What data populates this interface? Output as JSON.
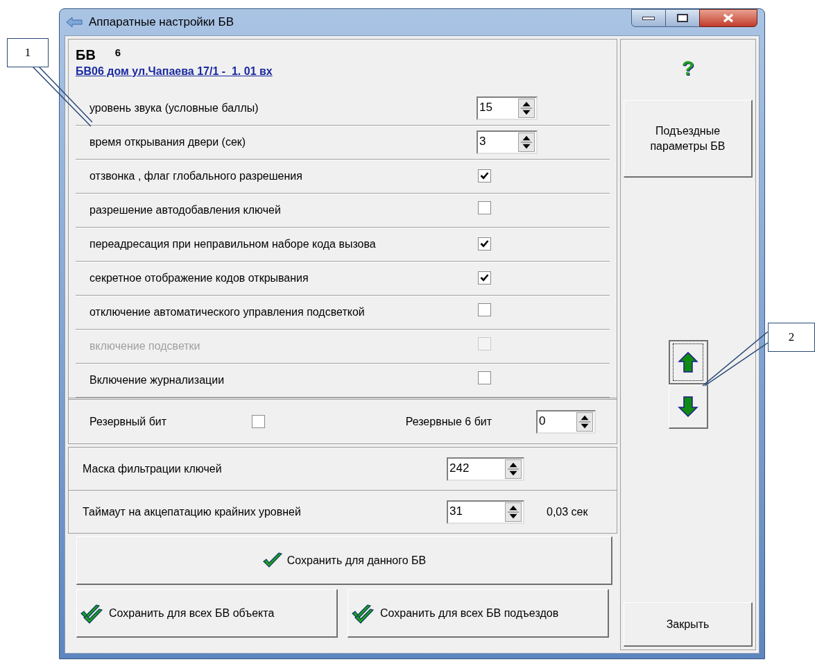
{
  "window": {
    "title": "Аппаратные настройки БВ"
  },
  "header": {
    "label": "БВ",
    "number": "6",
    "link": "БВ06 дом ул.Чапаева 17/1 -  1. 01 вх"
  },
  "settings": [
    {
      "kind": "spin",
      "label": "уровень звука (условные баллы)",
      "value": "15"
    },
    {
      "kind": "spin",
      "label": "время открывания двери (сек)",
      "value": "3"
    },
    {
      "kind": "check",
      "label": "отзвонка , флаг глобального разрешения",
      "checked": true,
      "disabled": false
    },
    {
      "kind": "check",
      "label": "разрешение автодобавления ключей",
      "checked": false,
      "disabled": false
    },
    {
      "kind": "check",
      "label": "переадресация при неправильном наборе кода вызова",
      "checked": true,
      "disabled": false
    },
    {
      "kind": "check",
      "label": "секретное отображение кодов открывания",
      "checked": true,
      "disabled": false
    },
    {
      "kind": "check",
      "label": "отключение автоматического управления подсветкой",
      "checked": false,
      "disabled": false
    },
    {
      "kind": "check",
      "label": "включение подсветки",
      "checked": false,
      "disabled": true
    },
    {
      "kind": "check",
      "label": "Включение журнализации",
      "checked": false,
      "disabled": false
    }
  ],
  "reserve": {
    "bit_label": "Резервный бит",
    "bit_checked": false,
    "bits6_label": "Резервные 6 бит",
    "bits6_value": "0"
  },
  "key_mask": {
    "label": "Маска фильтрации ключей",
    "value": "242"
  },
  "timeout": {
    "label": "Таймаут на акцепатацию крайних уровней",
    "value": "31",
    "reading": "0,03 сек"
  },
  "save_buttons": [
    {
      "kind": "single",
      "label": "Сохранить для данного БВ"
    },
    {
      "kind": "double",
      "label": "Сохранить для всех БВ объекта"
    },
    {
      "kind": "double",
      "label": "Сохранить для всех БВ подъездов"
    }
  ],
  "side": {
    "help": "?",
    "entrance_button": "Подъездные параметры БВ",
    "close_button": "Закрыть"
  },
  "move_buttons": [
    {
      "kind": "up",
      "focused": true
    },
    {
      "kind": "down",
      "focused": false
    }
  ],
  "callouts": [
    {
      "label": "1"
    },
    {
      "label": "2"
    }
  ]
}
